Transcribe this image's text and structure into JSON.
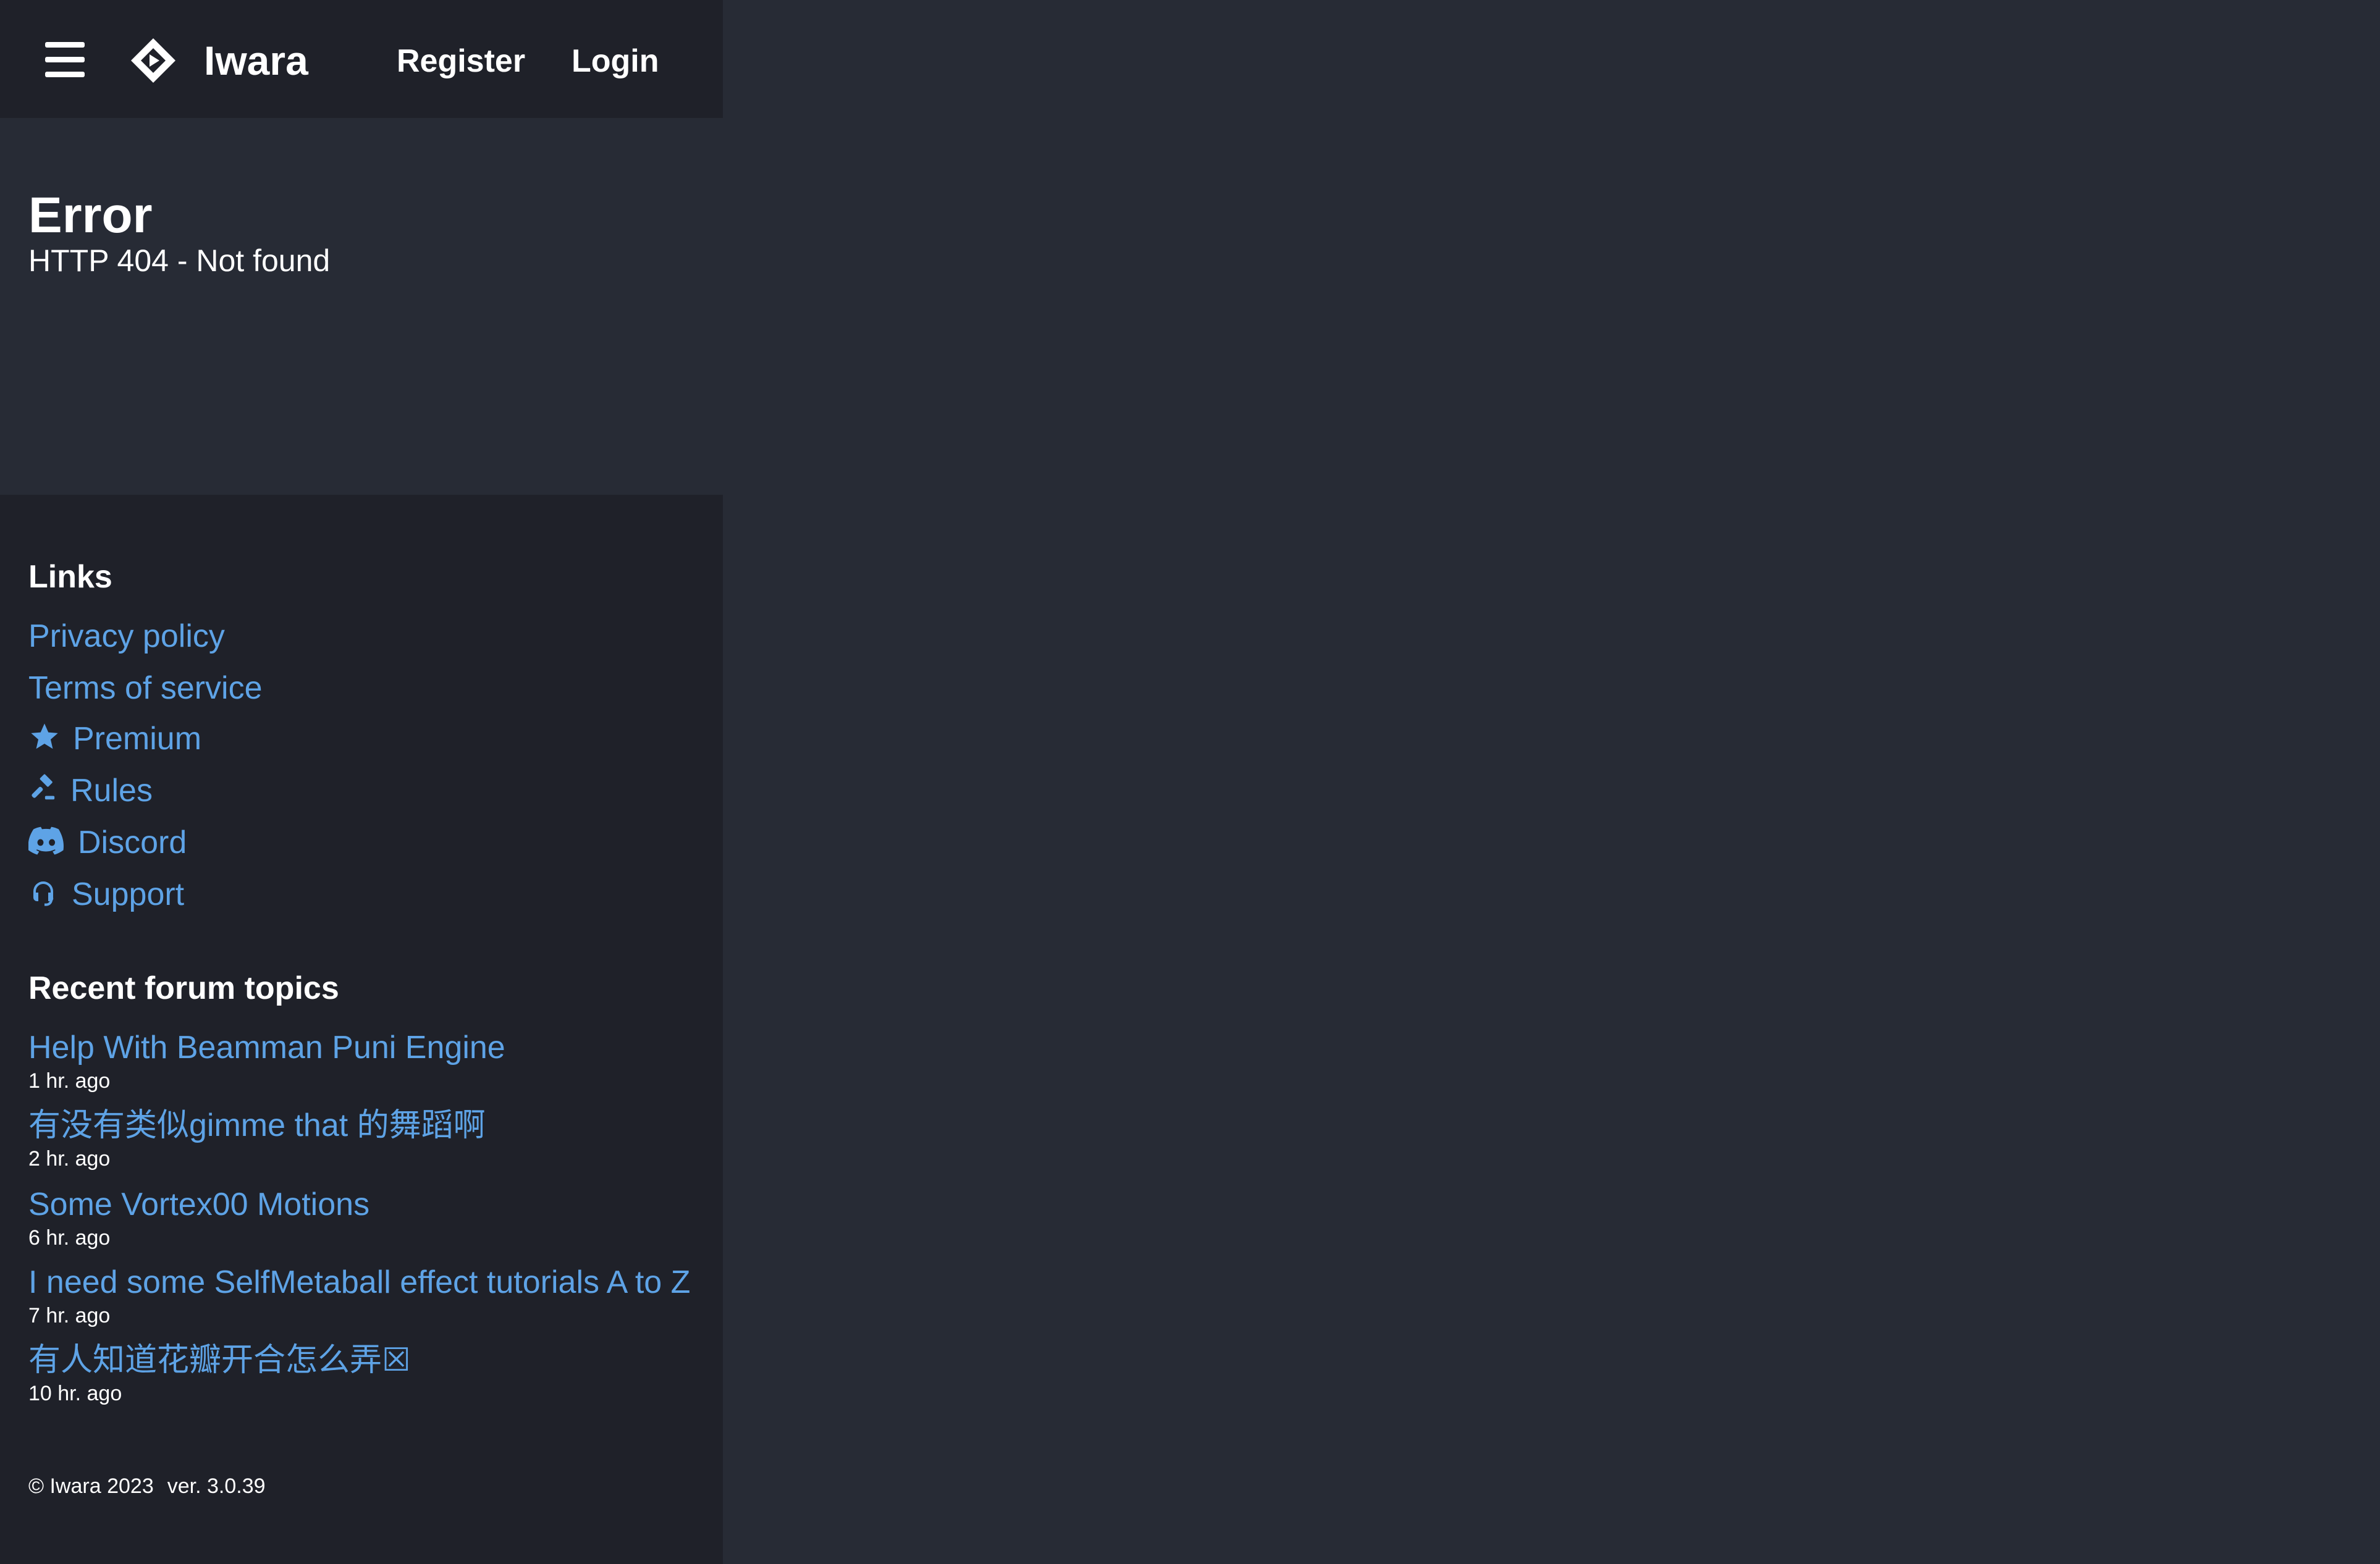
{
  "header": {
    "brand": "Iwara",
    "nav": {
      "register": "Register",
      "login": "Login"
    }
  },
  "error": {
    "title": "Error",
    "message": "HTTP 404 - Not found"
  },
  "footer": {
    "links_title": "Links",
    "links": [
      {
        "label": "Privacy policy",
        "icon": "none"
      },
      {
        "label": "Terms of service",
        "icon": "none"
      },
      {
        "label": "Premium",
        "icon": "star-icon"
      },
      {
        "label": "Rules",
        "icon": "gavel-icon"
      },
      {
        "label": "Discord",
        "icon": "discord-icon"
      },
      {
        "label": "Support",
        "icon": "headset-icon"
      }
    ],
    "topics_title": "Recent forum topics",
    "topics": [
      {
        "title": "Help With Beamman Puni Engine",
        "time": "1 hr. ago"
      },
      {
        "title": "有没有类似gimme that 的舞蹈啊",
        "time": "2 hr. ago"
      },
      {
        "title": "Some Vortex00 Motions",
        "time": "6 hr. ago"
      },
      {
        "title": "I need some SelfMetaball effect tutorials A to Z",
        "time": "7 hr. ago"
      },
      {
        "title": "有人知道花瓣开合怎么弄☒",
        "time": "10 hr. ago"
      }
    ],
    "copyright": "© Iwara 2023",
    "version": "ver. 3.0.39"
  },
  "colors": {
    "background": "#272b35",
    "header_bg": "#1f2129",
    "link": "#5ea3e6",
    "text": "#ffffff"
  }
}
